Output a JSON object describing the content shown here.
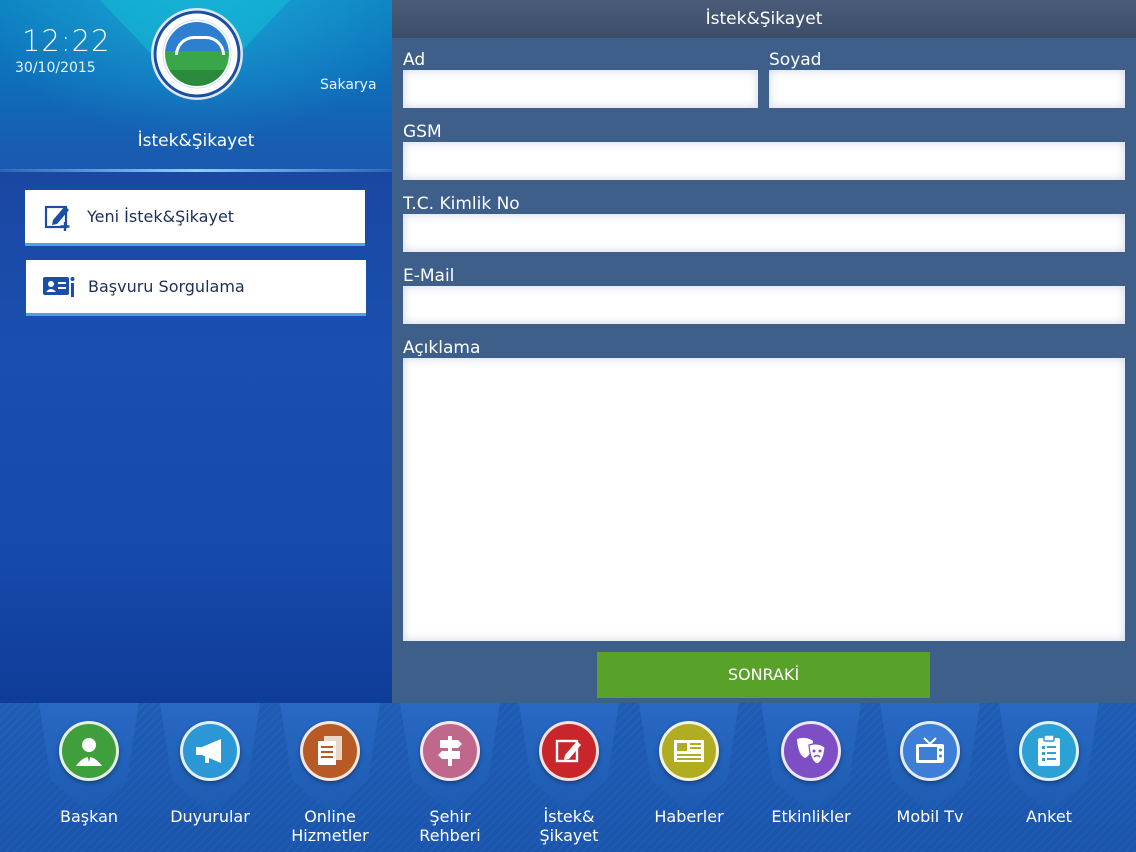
{
  "header": {
    "time": "12:22",
    "date": "30/10/2015",
    "city": "Sakarya",
    "title": "İstek&Şikayet"
  },
  "sidebar": {
    "items": [
      {
        "label": "Yeni İstek&Şikayet",
        "icon": "edit-plus-icon"
      },
      {
        "label": "Başvuru Sorgulama",
        "icon": "id-card-info-icon"
      }
    ]
  },
  "form": {
    "title": "İstek&Şikayet",
    "fields": {
      "ad": {
        "label": "Ad",
        "value": ""
      },
      "soyad": {
        "label": "Soyad",
        "value": ""
      },
      "gsm": {
        "label": "GSM",
        "value": ""
      },
      "tc": {
        "label": "T.C. Kimlik No",
        "value": ""
      },
      "email": {
        "label": "E-Mail",
        "value": ""
      },
      "aciklama": {
        "label": "Açıklama",
        "value": ""
      }
    },
    "next_label": "SONRAKİ"
  },
  "tabs": [
    {
      "label1": "Başkan",
      "label2": "",
      "color": "#3f9f3c",
      "icon": "person-icon"
    },
    {
      "label1": "Duyurular",
      "label2": "",
      "color": "#2b97d6",
      "icon": "megaphone-icon"
    },
    {
      "label1": "Online",
      "label2": "Hizmetler",
      "color": "#b85a26",
      "icon": "documents-icon"
    },
    {
      "label1": "Şehir",
      "label2": "Rehberi",
      "color": "#c0688c",
      "icon": "signpost-icon"
    },
    {
      "label1": "İstek&",
      "label2": "Şikayet",
      "color": "#c8262a",
      "icon": "edit-icon"
    },
    {
      "label1": "Haberler",
      "label2": "",
      "color": "#b1ad22",
      "icon": "newspaper-icon"
    },
    {
      "label1": "Etkinlikler",
      "label2": "",
      "color": "#7e4fc4",
      "icon": "theater-masks-icon"
    },
    {
      "label1": "Mobil Tv",
      "label2": "",
      "color": "#3d7fd6",
      "icon": "tv-icon"
    },
    {
      "label1": "Anket",
      "label2": "",
      "color": "#2ba1d6",
      "icon": "clipboard-icon"
    }
  ]
}
